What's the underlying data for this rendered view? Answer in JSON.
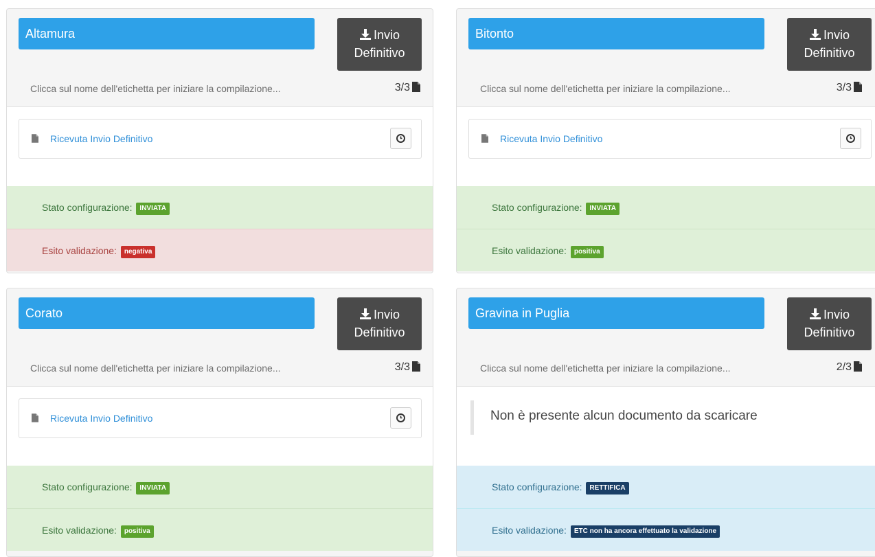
{
  "hint_text": "Clicca sul nome dell'etichetta per iniziare la compilazione...",
  "button_line1": "Invio",
  "button_line2": "Definitivo",
  "stato_label": "Stato configurazione:",
  "esito_label": "Esito validazione:",
  "cards": [
    {
      "title": "Altamura",
      "count": "3/3",
      "doc_label": "Ricevuta Invio Definitivo",
      "stato_badge": "INVIATA",
      "esito_badge": "negativa"
    },
    {
      "title": "Bitonto",
      "count": "3/3",
      "doc_label": "Ricevuta Invio Definitivo",
      "stato_badge": "INVIATA",
      "esito_badge": "positiva"
    },
    {
      "title": "Corato",
      "count": "3/3",
      "doc_label": "Ricevuta Invio Definitivo",
      "stato_badge": "INVIATA",
      "esito_badge": "positiva"
    },
    {
      "title": "Gravina in Puglia",
      "count": "2/3",
      "empty_message": "Non è presente alcun documento da scaricare",
      "stato_badge": "RETTIFICA",
      "esito_badge": "ETC non ha ancora effettuato la validazione"
    }
  ],
  "colors": {
    "title_blue": "#2ea1e8",
    "button_dark": "#4a4a4a",
    "success_bg": "#dff0d8",
    "danger_bg": "#f2dede",
    "info_bg": "#d9edf7"
  }
}
